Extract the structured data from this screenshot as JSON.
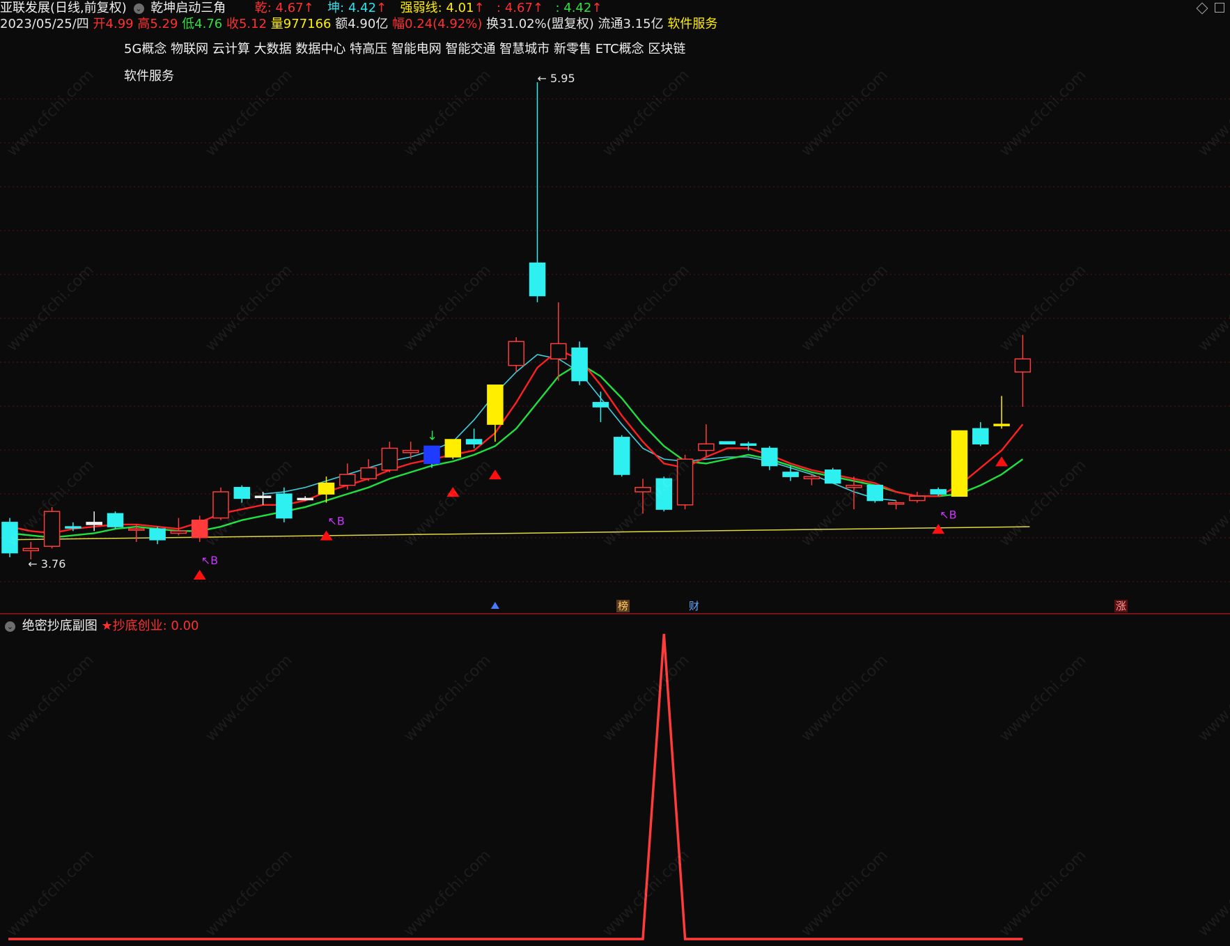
{
  "header": {
    "stock": "亚联发展(日线,前复权)",
    "indicator": "乾坤启动三角",
    "qian_label": "乾: ",
    "qian_value": "4.67",
    "kun_label": "坤: ",
    "kun_value": "4.42",
    "qrx_label": "强弱线: ",
    "qrx_value": "4.01",
    "extra1": ": 4.67",
    "extra2": ": 4.42",
    "arrow": "↑",
    "date": "2023/05/25/四",
    "open_label": "开",
    "open": "4.99",
    "high_label": "高",
    "high": "5.29",
    "low_label": "低",
    "low": "4.76",
    "close_label": "收",
    "close": "5.12",
    "vol_label": "量",
    "vol": "977166",
    "amt_label": "额",
    "amt": "4.90亿",
    "chg_label": "幅",
    "chg": "0.24(4.92%)",
    "turnover": "换31.02%(盟复权)",
    "float": "流通3.15亿",
    "sector": "软件服务",
    "concepts": [
      "5G概念",
      "物联网",
      "云计算",
      "大数据",
      "数据中心",
      "特高压",
      "智能电网",
      "智能交通",
      "智慧城市",
      "新零售",
      "ETC概念",
      "区块链"
    ],
    "concepts2": "软件服务"
  },
  "sub": {
    "title": "绝密抄底副图",
    "label": "★抄底创业: ",
    "value": "0.00"
  },
  "watermark": "www.cfchi.com",
  "colors": {
    "up": "#ff3b3b",
    "down": "#2ff0f0",
    "yellow": "#ffee00",
    "blue": "#1f3bff",
    "qian": "#ff2020",
    "kun": "#20e040",
    "qrx": "#40d0e0",
    "long": "#e0d840",
    "triangle": "#ff1010",
    "buy": "#cc33ff"
  },
  "chart_data": [
    {
      "type": "candlestick",
      "title": "乾坤启动三角",
      "ylim": [
        3.5,
        6.2
      ],
      "candles": [
        {
          "o": 3.93,
          "h": 3.95,
          "l": 3.77,
          "c": 3.79,
          "color": "down"
        },
        {
          "o": 3.81,
          "h": 3.84,
          "l": 3.76,
          "c": 3.8,
          "color": "up"
        },
        {
          "o": 3.82,
          "h": 4.0,
          "l": 3.81,
          "c": 3.98,
          "color": "up"
        },
        {
          "o": 3.91,
          "h": 3.93,
          "l": 3.89,
          "c": 3.91,
          "color": "down"
        },
        {
          "o": 3.92,
          "h": 3.98,
          "l": 3.89,
          "c": 3.93,
          "color": "cross"
        },
        {
          "o": 3.97,
          "h": 3.98,
          "l": 3.9,
          "c": 3.91,
          "color": "down"
        },
        {
          "o": 3.9,
          "h": 3.92,
          "l": 3.84,
          "c": 3.9,
          "color": "up"
        },
        {
          "o": 3.9,
          "h": 3.91,
          "l": 3.83,
          "c": 3.85,
          "color": "down"
        },
        {
          "o": 3.88,
          "h": 3.95,
          "l": 3.87,
          "c": 3.89,
          "color": "up"
        },
        {
          "o": 3.86,
          "h": 3.96,
          "l": 3.84,
          "c": 3.94,
          "color": "upfill"
        },
        {
          "o": 3.95,
          "h": 4.09,
          "l": 3.94,
          "c": 4.07,
          "color": "up"
        },
        {
          "o": 4.09,
          "h": 4.1,
          "l": 4.02,
          "c": 4.04,
          "color": "down"
        },
        {
          "o": 4.05,
          "h": 4.07,
          "l": 4.01,
          "c": 4.05,
          "color": "cross"
        },
        {
          "o": 4.06,
          "h": 4.09,
          "l": 3.93,
          "c": 3.95,
          "color": "down"
        },
        {
          "o": 4.04,
          "h": 4.05,
          "l": 4.03,
          "c": 4.04,
          "color": "cross"
        },
        {
          "o": 4.06,
          "h": 4.14,
          "l": 4.02,
          "c": 4.11,
          "color": "yellow"
        },
        {
          "o": 4.1,
          "h": 4.2,
          "l": 4.08,
          "c": 4.15,
          "color": "up"
        },
        {
          "o": 4.13,
          "h": 4.22,
          "l": 4.12,
          "c": 4.18,
          "color": "up"
        },
        {
          "o": 4.17,
          "h": 4.3,
          "l": 4.16,
          "c": 4.27,
          "color": "up"
        },
        {
          "o": 4.25,
          "h": 4.3,
          "l": 4.22,
          "c": 4.26,
          "color": "up"
        },
        {
          "o": 4.28,
          "h": 4.27,
          "l": 4.18,
          "c": 4.2,
          "color": "blue"
        },
        {
          "o": 4.23,
          "h": 4.31,
          "l": 4.22,
          "c": 4.31,
          "color": "yellow"
        },
        {
          "o": 4.31,
          "h": 4.36,
          "l": 4.27,
          "c": 4.29,
          "color": "down"
        },
        {
          "o": 4.38,
          "h": 4.56,
          "l": 4.3,
          "c": 4.56,
          "color": "yellow"
        },
        {
          "o": 4.76,
          "h": 4.78,
          "l": 4.62,
          "c": 4.65,
          "color": "up"
        },
        {
          "o": 5.12,
          "h": 5.95,
          "l": 4.94,
          "c": 4.97,
          "color": "down"
        },
        {
          "o": 4.68,
          "h": 4.94,
          "l": 4.58,
          "c": 4.75,
          "color": "up"
        },
        {
          "o": 4.73,
          "h": 4.76,
          "l": 4.56,
          "c": 4.58,
          "color": "down"
        },
        {
          "o": 4.48,
          "h": 4.53,
          "l": 4.39,
          "c": 4.46,
          "color": "down"
        },
        {
          "o": 4.32,
          "h": 4.33,
          "l": 4.14,
          "c": 4.15,
          "color": "down"
        },
        {
          "o": 4.09,
          "h": 4.13,
          "l": 3.97,
          "c": 4.07,
          "color": "up"
        },
        {
          "o": 4.13,
          "h": 4.14,
          "l": 3.98,
          "c": 3.99,
          "color": "down"
        },
        {
          "o": 4.01,
          "h": 4.24,
          "l": 3.99,
          "c": 4.22,
          "color": "up"
        },
        {
          "o": 4.26,
          "h": 4.38,
          "l": 4.23,
          "c": 4.29,
          "color": "up"
        },
        {
          "o": 4.29,
          "h": 4.3,
          "l": 4.29,
          "c": 4.3,
          "color": "down"
        },
        {
          "o": 4.29,
          "h": 4.3,
          "l": 4.26,
          "c": 4.29,
          "color": "down"
        },
        {
          "o": 4.27,
          "h": 4.28,
          "l": 4.17,
          "c": 4.19,
          "color": "down"
        },
        {
          "o": 4.16,
          "h": 4.19,
          "l": 4.12,
          "c": 4.14,
          "color": "down"
        },
        {
          "o": 4.13,
          "h": 4.15,
          "l": 4.1,
          "c": 4.14,
          "color": "up"
        },
        {
          "o": 4.17,
          "h": 4.18,
          "l": 4.12,
          "c": 4.11,
          "color": "down"
        },
        {
          "o": 4.1,
          "h": 4.14,
          "l": 3.99,
          "c": 4.09,
          "color": "up"
        },
        {
          "o": 4.1,
          "h": 4.1,
          "l": 4.02,
          "c": 4.03,
          "color": "down"
        },
        {
          "o": 4.02,
          "h": 4.03,
          "l": 3.99,
          "c": 4.02,
          "color": "up"
        },
        {
          "o": 4.03,
          "h": 4.07,
          "l": 4.02,
          "c": 4.05,
          "color": "up"
        },
        {
          "o": 4.08,
          "h": 4.09,
          "l": 4.05,
          "c": 4.06,
          "color": "down"
        },
        {
          "o": 4.05,
          "h": 4.35,
          "l": 4.05,
          "c": 4.35,
          "color": "yellow"
        },
        {
          "o": 4.29,
          "h": 4.39,
          "l": 4.28,
          "c": 4.36,
          "color": "down"
        },
        {
          "o": 4.38,
          "h": 4.51,
          "l": 4.36,
          "c": 4.38,
          "color": "yellow"
        },
        {
          "o": 4.68,
          "h": 4.79,
          "l": 4.46,
          "c": 4.62,
          "color": "up"
        }
      ],
      "qian": [
        3.91,
        3.89,
        3.88,
        3.9,
        3.91,
        3.92,
        3.92,
        3.91,
        3.9,
        3.93,
        3.97,
        3.99,
        4.01,
        4.01,
        4.03,
        4.07,
        4.1,
        4.13,
        4.17,
        4.2,
        4.22,
        4.24,
        4.26,
        4.34,
        4.48,
        4.64,
        4.72,
        4.68,
        4.56,
        4.42,
        4.3,
        4.2,
        4.18,
        4.23,
        4.27,
        4.27,
        4.24,
        4.2,
        4.17,
        4.15,
        4.13,
        4.11,
        4.07,
        4.05,
        4.05,
        4.1,
        4.18,
        4.26,
        4.38
      ],
      "kun": [
        3.88,
        3.87,
        3.86,
        3.87,
        3.88,
        3.9,
        3.91,
        3.9,
        3.89,
        3.89,
        3.91,
        3.94,
        3.96,
        3.98,
        4.0,
        4.03,
        4.06,
        4.09,
        4.13,
        4.16,
        4.19,
        4.21,
        4.24,
        4.28,
        4.36,
        4.48,
        4.6,
        4.66,
        4.6,
        4.5,
        4.38,
        4.28,
        4.21,
        4.2,
        4.22,
        4.24,
        4.22,
        4.19,
        4.16,
        4.14,
        4.12,
        4.1,
        4.07,
        4.05,
        4.05,
        4.06,
        4.1,
        4.15,
        4.22
      ],
      "qrx_start": 12,
      "qrx": [
        4.06,
        4.07,
        4.09,
        4.12,
        4.15,
        4.18,
        4.21,
        4.23,
        4.26,
        4.3,
        4.4,
        4.52,
        4.62,
        4.7,
        4.68,
        4.62,
        4.5,
        4.38,
        4.27,
        4.22,
        4.21,
        4.22,
        4.23,
        4.23,
        4.21,
        4.18,
        4.15,
        4.11,
        4.07,
        4.04,
        4.03
      ],
      "long_line": [
        3.85,
        3.91
      ],
      "triangles": [
        9,
        15,
        21,
        23,
        44,
        47
      ],
      "buy_marks": [
        9,
        15,
        44
      ],
      "annotations": [
        {
          "text": "5.95",
          "at": 25,
          "value": 5.95
        },
        {
          "text": "3.76",
          "at": 1,
          "value": 3.76
        }
      ]
    },
    {
      "type": "line",
      "title": "绝密抄底副图",
      "series": [
        {
          "name": "抄底创业",
          "values": [
            0,
            0,
            0,
            0,
            0,
            0,
            0,
            0,
            0,
            0,
            0,
            0,
            0,
            0,
            0,
            0,
            0,
            0,
            0,
            0,
            0,
            0,
            0,
            0,
            0,
            0,
            0,
            0,
            0,
            0,
            0,
            1,
            0,
            0,
            0,
            0,
            0,
            0,
            0,
            0,
            0,
            0,
            0,
            0,
            0,
            0,
            0,
            0,
            0
          ]
        }
      ]
    }
  ],
  "markers": {
    "bang": "榜",
    "cai": "财",
    "zhang": "涨"
  }
}
